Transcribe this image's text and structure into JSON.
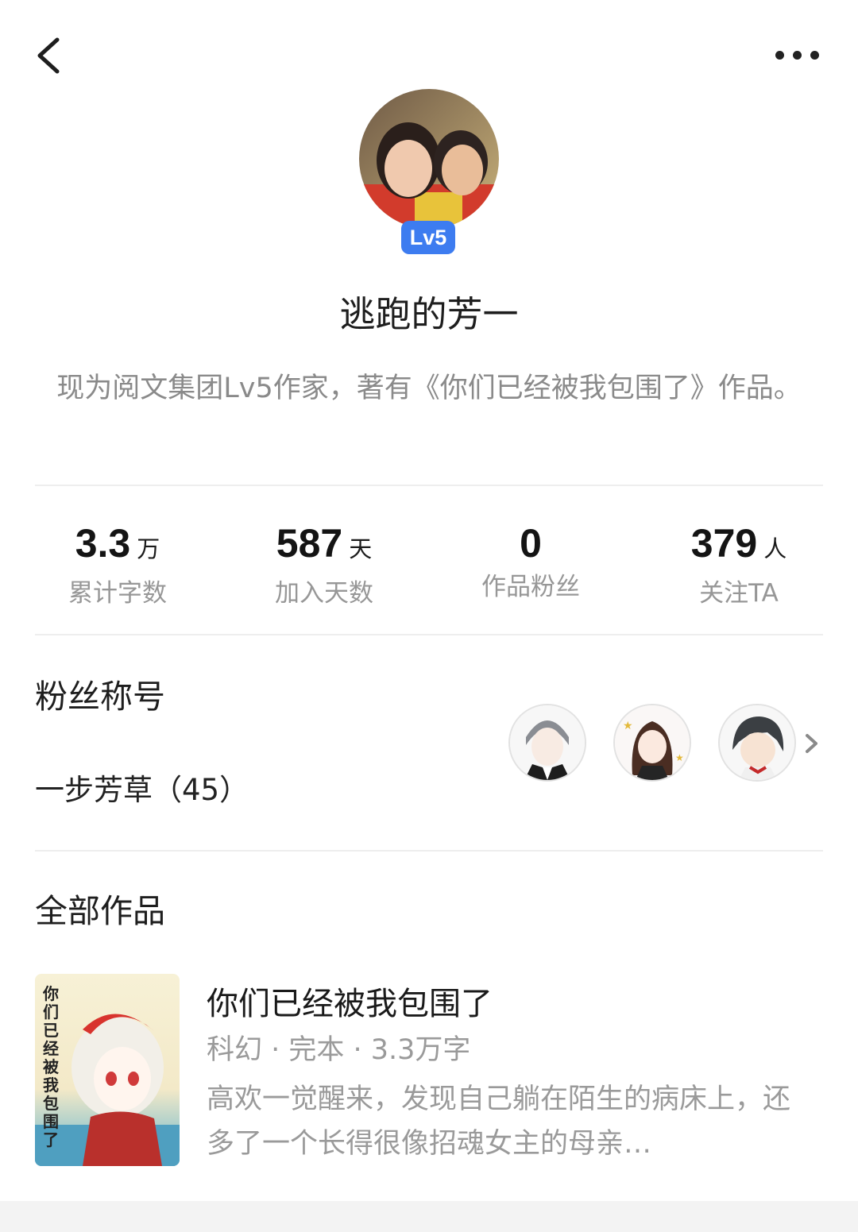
{
  "icons": {
    "back": "chevron-left-icon",
    "more": "more-horizontal-icon",
    "next": "chevron-right-icon"
  },
  "profile": {
    "level_badge": "Lv5",
    "username": "逃跑的芳一",
    "bio": "现为阅文集团Lv5作家，著有《你们已经被我包围了》作品。",
    "badge_color": "#3d7cf0"
  },
  "stats": [
    {
      "value": "3.3",
      "unit": "万",
      "label": "累计字数"
    },
    {
      "value": "587",
      "unit": "天",
      "label": "加入天数"
    },
    {
      "value": "0",
      "unit": "",
      "label": "作品粉丝"
    },
    {
      "value": "379",
      "unit": "人",
      "label": "关注TA"
    }
  ],
  "fans": {
    "title": "粉丝称号",
    "fan_title": "一步芳草（45）"
  },
  "works": {
    "title": "全部作品",
    "items": [
      {
        "title": "你们已经被我包围了",
        "meta": "科幻 · 完本 · 3.3万字",
        "description": "高欢一觉醒来，发现自己躺在陌生的病床上，还多了一个长得很像招魂女主的母亲…",
        "cover_text": "你们已经被我包围了"
      }
    ]
  }
}
